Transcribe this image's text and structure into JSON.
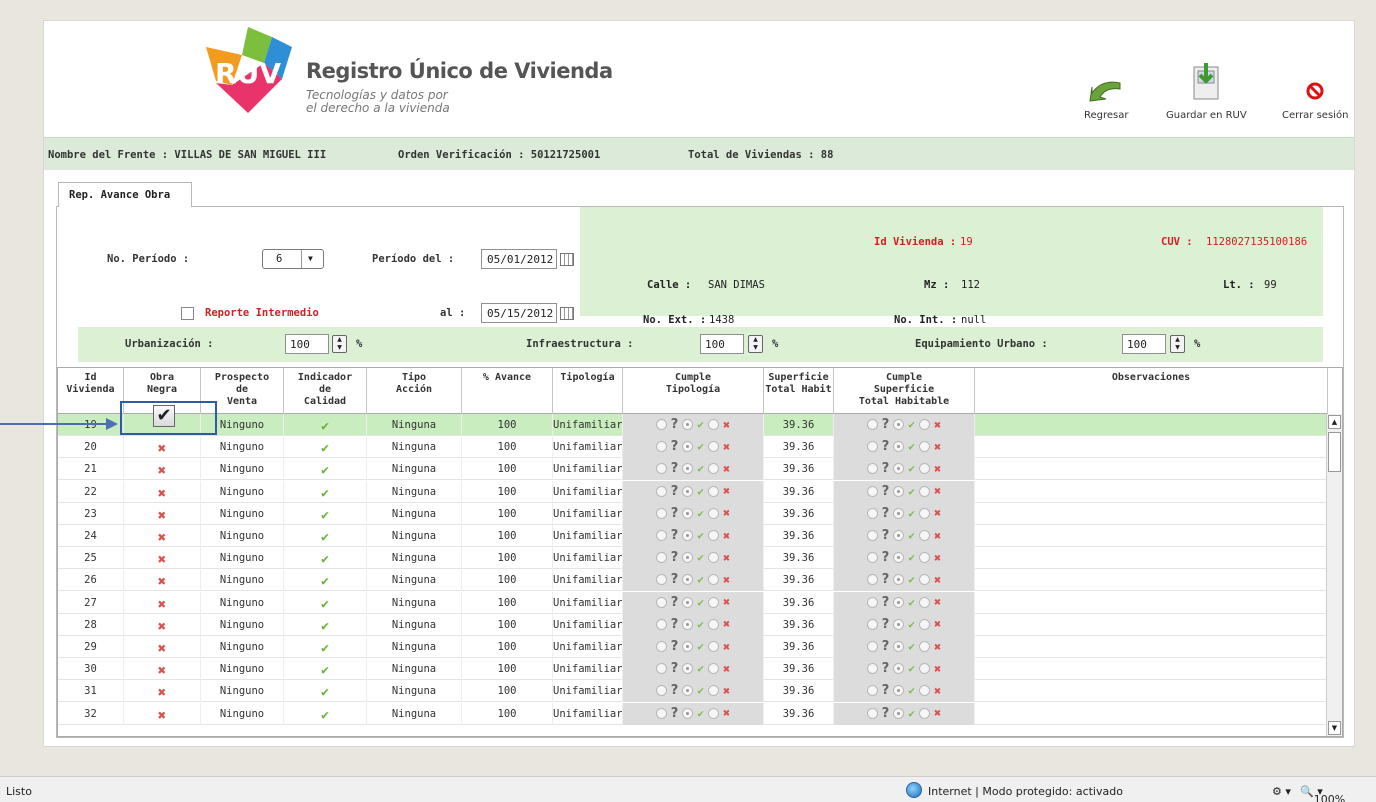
{
  "header": {
    "brand_logo": "RUV",
    "brand_title": "Registro Único de Vivienda",
    "brand_sub1": "Tecnologías y datos por",
    "brand_sub2": "el derecho a la vivienda",
    "regresar": "Regresar",
    "guardar": "Guardar en RUV",
    "cerrar": "Cerrar sesión"
  },
  "infobar": {
    "frente": "Nombre del Frente : VILLAS DE SAN MIGUEL III",
    "orden": "Orden Verificación : 50121725001",
    "total": "Total de Viviendas : 88"
  },
  "tab": {
    "label": "Rep. Avance Obra"
  },
  "form": {
    "periodo_label": "No. Período :",
    "periodo_value": "6",
    "periodo_del_label": "Período del :",
    "periodo_del_value": "05/01/2012",
    "reporte_label": "Reporte Intermedio",
    "al_label": "al :",
    "al_value": "05/15/2012"
  },
  "vivienda": {
    "id_label": "Id Vivienda :",
    "id_value": "19",
    "cuv_label": "CUV :",
    "cuv_value": "1128027135100186",
    "calle_label": "Calle :",
    "calle_value": "SAN DIMAS",
    "mz_label": "Mz :",
    "mz_value": "112",
    "lt_label": "Lt. :",
    "lt_value": "99",
    "noext_label": "No. Ext. :",
    "noext_value": "1438",
    "noint_label": "No. Int. :",
    "noint_value": "null"
  },
  "pct": {
    "urb_label": "Urbanización :",
    "urb_value": "100",
    "infra_label": "Infraestructura :",
    "infra_value": "100",
    "equip_label": "Equipamiento Urbano :",
    "equip_value": "100",
    "unit": "%"
  },
  "table": {
    "headers": {
      "id": [
        "Id",
        "Vivienda"
      ],
      "obra": [
        "Obra",
        "Negra"
      ],
      "prospecto": [
        "Prospecto",
        "de",
        "Venta"
      ],
      "indicador": [
        "Indicador",
        "de",
        "Calidad"
      ],
      "tipo": [
        "Tipo",
        "Acción"
      ],
      "avance": [
        "% Avance"
      ],
      "tipologia": [
        "Tipología"
      ],
      "cumple_tip": [
        "Cumple",
        "Tipología"
      ],
      "superficie": [
        "Superficie",
        "Total Habit"
      ],
      "cumple_sup": [
        "Cumple",
        "Superficie",
        "Total Habitable"
      ],
      "obs": [
        "Observaciones"
      ]
    },
    "rows": [
      {
        "id": "19",
        "prospecto": "Ninguno",
        "tipo": "Ninguna",
        "avance": "100",
        "tipologia": "Unifamiliar",
        "superficie": "39.36"
      },
      {
        "id": "20",
        "prospecto": "Ninguno",
        "tipo": "Ninguna",
        "avance": "100",
        "tipologia": "Unifamiliar",
        "superficie": "39.36"
      },
      {
        "id": "21",
        "prospecto": "Ninguno",
        "tipo": "Ninguna",
        "avance": "100",
        "tipologia": "Unifamiliar",
        "superficie": "39.36"
      },
      {
        "id": "22",
        "prospecto": "Ninguno",
        "tipo": "Ninguna",
        "avance": "100",
        "tipologia": "Unifamiliar",
        "superficie": "39.36"
      },
      {
        "id": "23",
        "prospecto": "Ninguno",
        "tipo": "Ninguna",
        "avance": "100",
        "tipologia": "Unifamiliar",
        "superficie": "39.36"
      },
      {
        "id": "24",
        "prospecto": "Ninguno",
        "tipo": "Ninguna",
        "avance": "100",
        "tipologia": "Unifamiliar",
        "superficie": "39.36"
      },
      {
        "id": "25",
        "prospecto": "Ninguno",
        "tipo": "Ninguna",
        "avance": "100",
        "tipologia": "Unifamiliar",
        "superficie": "39.36"
      },
      {
        "id": "26",
        "prospecto": "Ninguno",
        "tipo": "Ninguna",
        "avance": "100",
        "tipologia": "Unifamiliar",
        "superficie": "39.36"
      },
      {
        "id": "27",
        "prospecto": "Ninguno",
        "tipo": "Ninguna",
        "avance": "100",
        "tipologia": "Unifamiliar",
        "superficie": "39.36"
      },
      {
        "id": "28",
        "prospecto": "Ninguno",
        "tipo": "Ninguna",
        "avance": "100",
        "tipologia": "Unifamiliar",
        "superficie": "39.36"
      },
      {
        "id": "29",
        "prospecto": "Ninguno",
        "tipo": "Ninguna",
        "avance": "100",
        "tipologia": "Unifamiliar",
        "superficie": "39.36"
      },
      {
        "id": "30",
        "prospecto": "Ninguno",
        "tipo": "Ninguna",
        "avance": "100",
        "tipologia": "Unifamiliar",
        "superficie": "39.36"
      },
      {
        "id": "31",
        "prospecto": "Ninguno",
        "tipo": "Ninguna",
        "avance": "100",
        "tipologia": "Unifamiliar",
        "superficie": "39.36"
      },
      {
        "id": "32",
        "prospecto": "Ninguno",
        "tipo": "Ninguna",
        "avance": "100",
        "tipologia": "Unifamiliar",
        "superficie": "39.36"
      }
    ]
  },
  "statusbar": {
    "left": "Listo",
    "zone": "Internet | Modo protegido: activado",
    "zoom": "100%"
  },
  "colors": {
    "accent_green": "#dcf0d4",
    "selected_row": "#c9edbf",
    "red_text": "#cc2222",
    "callout_blue": "#2e5aa8"
  }
}
